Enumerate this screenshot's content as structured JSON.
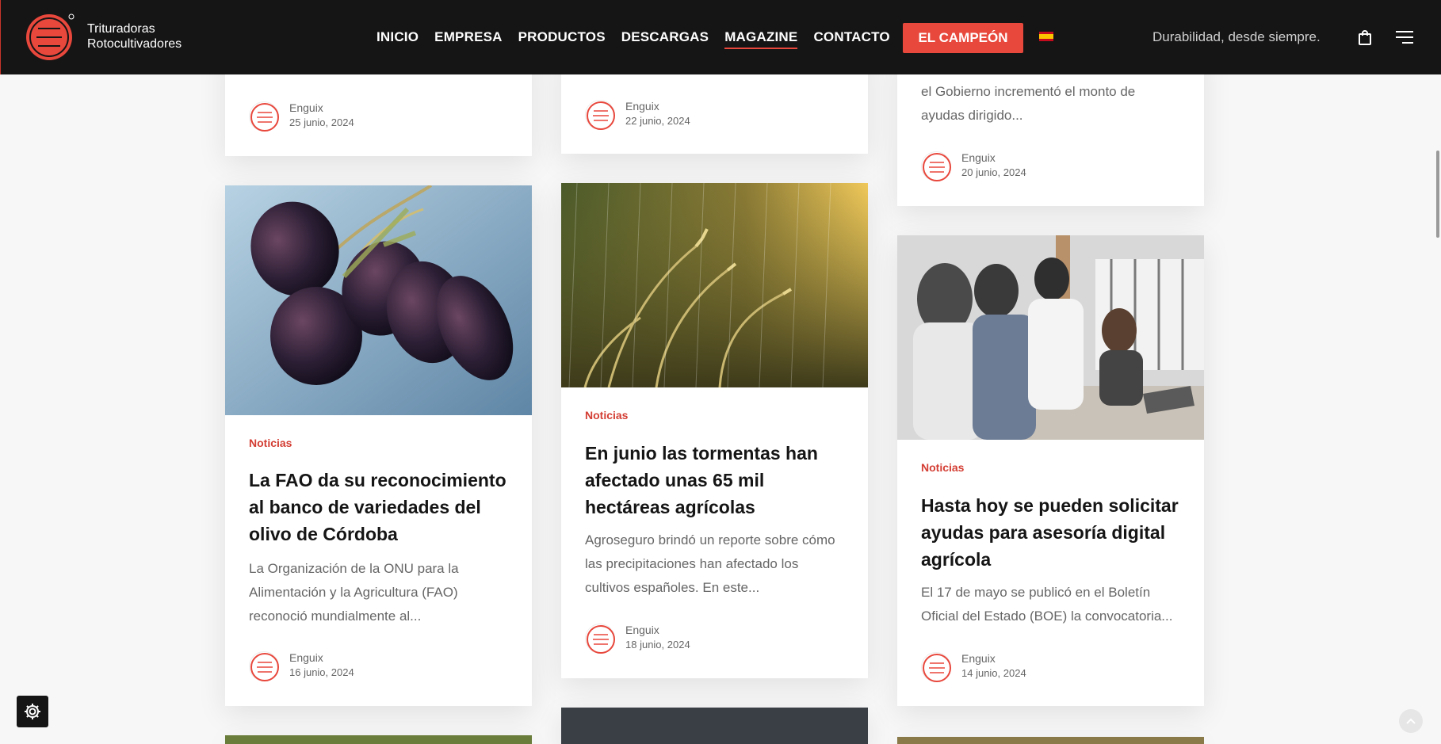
{
  "header": {
    "brand_line1": "Trituradoras",
    "brand_line2": "Rotocultivadores",
    "nav": [
      {
        "label": "INICIO"
      },
      {
        "label": "EMPRESA"
      },
      {
        "label": "PRODUCTOS"
      },
      {
        "label": "DESCARGAS"
      },
      {
        "label": "MAGAZINE"
      },
      {
        "label": "CONTACTO"
      }
    ],
    "active_nav": "MAGAZINE",
    "cta_label": "EL CAMPEÓN",
    "tagline": "Durabilidad, desde siempre.",
    "icons": [
      "shopping-bag-icon",
      "hamburger-menu-icon",
      "spain-flag-icon"
    ]
  },
  "top_cards": [
    {
      "author": "Enguix",
      "date": "25 junio, 2024"
    },
    {
      "author": "Enguix",
      "date": "22 junio, 2024"
    },
    {
      "excerpt_line1": "el Gobierno incrementó el monto de",
      "excerpt_line2": "ayudas dirigido...",
      "author": "Enguix",
      "date": "20 junio, 2024"
    }
  ],
  "posts": [
    {
      "category": "Noticias",
      "title": "La FAO da su reconocimiento al banco de variedades del olivo de Córdoba",
      "excerpt": "La Organización de la ONU para la Alimentación y la Agricultura (FAO) reconoció mundialmente al...",
      "author": "Enguix",
      "date": "16 junio, 2024"
    },
    {
      "category": "Noticias",
      "title": "En junio las tormentas han afectado unas 65 mil hectáreas agrícolas",
      "excerpt": "Agroseguro brindó un reporte sobre cómo las precipitaciones han afectado los cultivos españoles. En este...",
      "author": "Enguix",
      "date": "18 junio, 2024"
    },
    {
      "category": "Noticias",
      "title": "Hasta hoy se pueden solicitar ayudas para asesoría digital agrícola",
      "excerpt": "El 17 de mayo se publicó en el Boletín Oficial del Estado (BOE) la convocatoria...",
      "author": "Enguix",
      "date": "14 junio, 2024"
    }
  ],
  "colors": {
    "accent": "#e8473c",
    "header_bg": "#151515",
    "category": "#d33d33"
  }
}
